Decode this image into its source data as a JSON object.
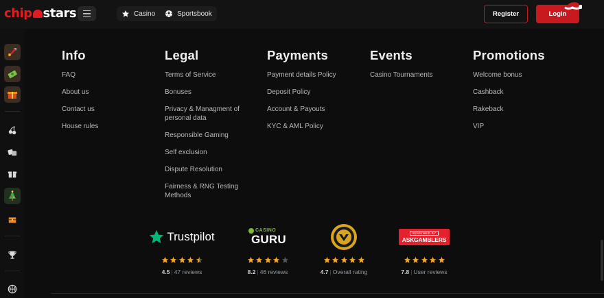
{
  "header": {
    "logo_prefix": "chip",
    "logo_suffix": "stars",
    "nav": [
      {
        "label": "Casino",
        "icon": "star-icon"
      },
      {
        "label": "Sportsbook",
        "icon": "soccer-ball-icon"
      }
    ],
    "register_label": "Register",
    "login_label": "Login"
  },
  "sidebar": {
    "items": [
      {
        "icon": "rocket-icon"
      },
      {
        "icon": "cash-icon"
      },
      {
        "icon": "gift-box-icon"
      },
      {
        "icon": "cherries-icon"
      },
      {
        "icon": "dice-icon"
      },
      {
        "icon": "present-icon"
      },
      {
        "icon": "christmas-tree-icon"
      },
      {
        "icon": "treasure-chest-icon"
      },
      {
        "icon": "trophy-icon"
      },
      {
        "icon": "basketball-icon"
      }
    ]
  },
  "footer": {
    "columns": [
      {
        "title": "Info",
        "links": [
          "FAQ",
          "About us",
          "Contact us",
          "House rules"
        ]
      },
      {
        "title": "Legal",
        "links": [
          "Terms of Service",
          "Bonuses",
          "Privacy & Managment of personal data",
          "Responsible Gaming",
          "Self exclusion",
          "Dispute Resolution",
          "Fairness & RNG Testing Methods"
        ]
      },
      {
        "title": "Payments",
        "links": [
          "Payment details Policy",
          "Deposit Policy",
          "Account & Payouts",
          "KYC & AML Policy"
        ]
      },
      {
        "title": "Events",
        "links": [
          "Casino Tournaments"
        ]
      },
      {
        "title": "Promotions",
        "links": [
          "Welcome bonus",
          "Cashback",
          "Rakeback",
          "VIP"
        ]
      }
    ],
    "reviews": [
      {
        "name": "Trustpilot",
        "rating": "4.5",
        "rating_value": 4.5,
        "count": "47 reviews"
      },
      {
        "name": "CASINO GURU",
        "rating": "8.2",
        "rating_value": 4,
        "count": "46 reviews"
      },
      {
        "name": "Casino Rewards",
        "rating": "4.7",
        "rating_value": 5,
        "count": "Overall rating"
      },
      {
        "name": "REVIEWED BY ASKGAMBLERS",
        "rating": "7.8",
        "rating_value": 5,
        "count": "User reviews"
      }
    ],
    "colors": {
      "accent": "#c8191f",
      "star": "#f5a623",
      "star_empty": "#555555",
      "trustpilot_green": "#00b67a"
    }
  }
}
